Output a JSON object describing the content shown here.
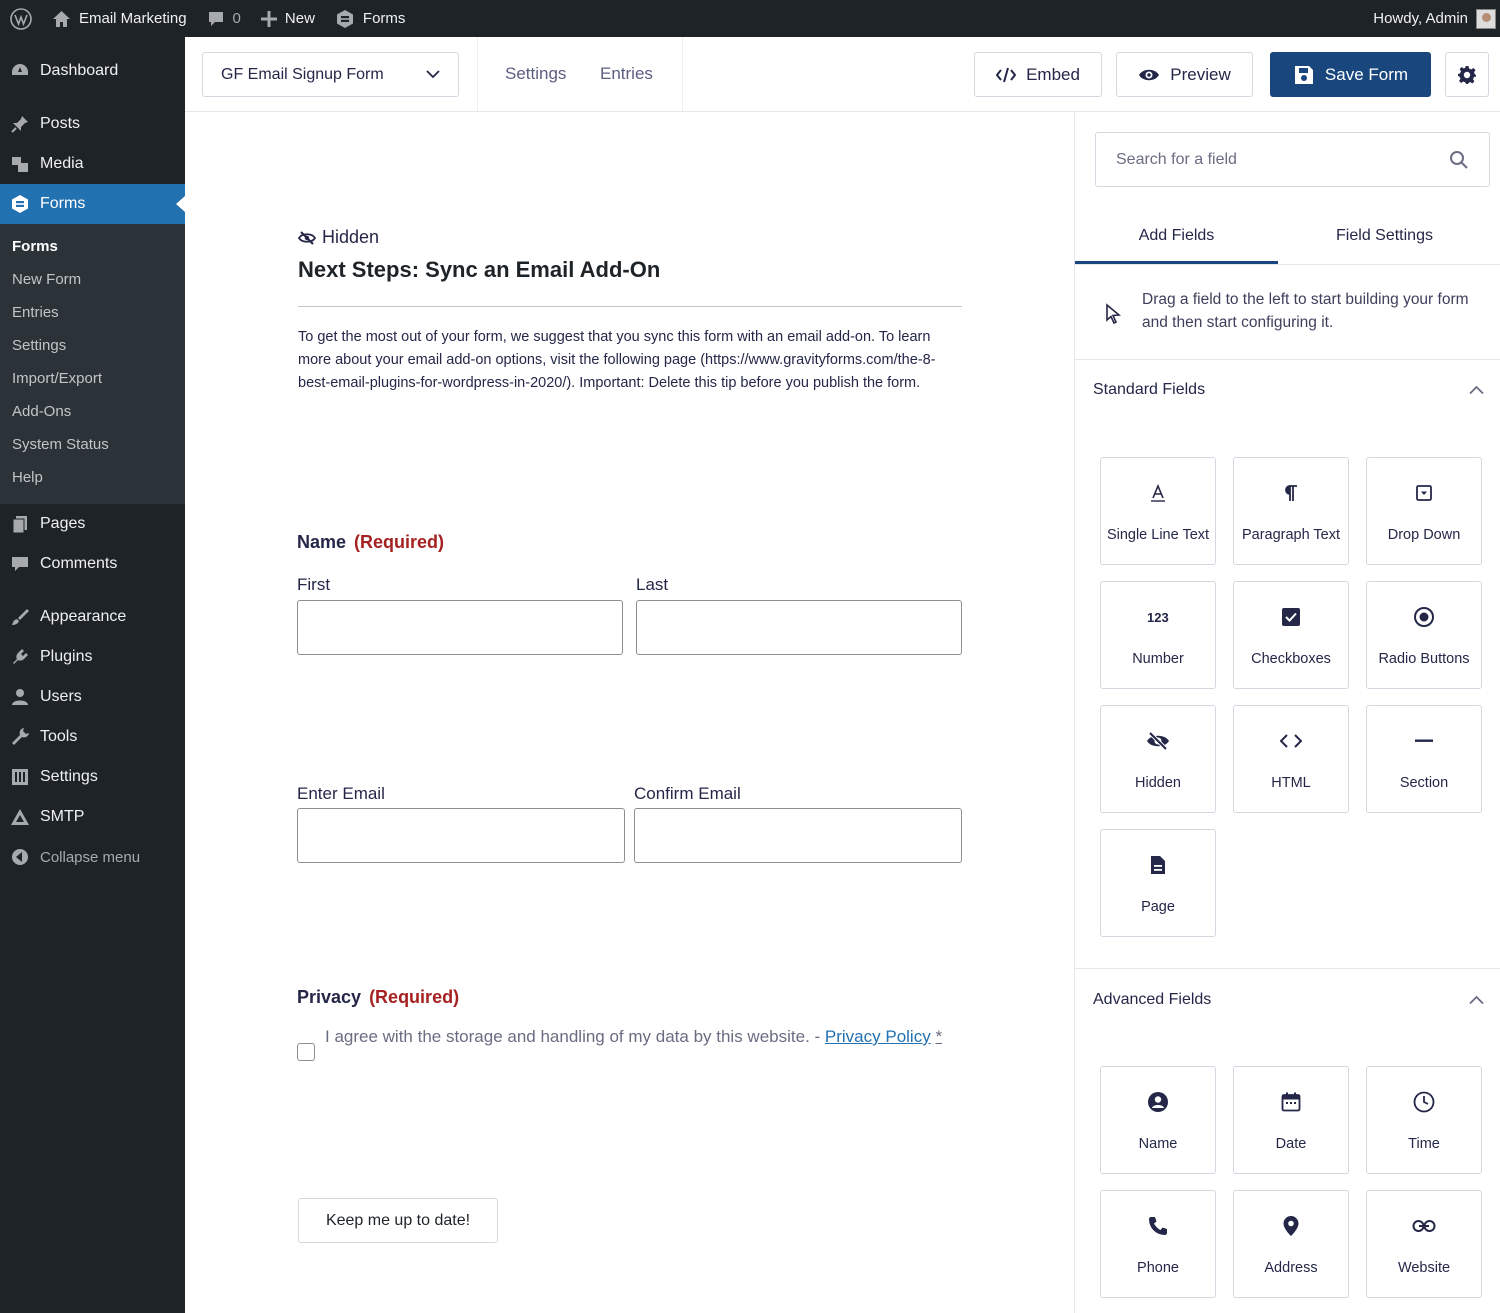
{
  "adminbar": {
    "site_name": "Email Marketing",
    "comments_count": "0",
    "new_label": "New",
    "forms_label": "Forms",
    "howdy": "Howdy, Admin"
  },
  "sidebar": {
    "dashboard": "Dashboard",
    "posts": "Posts",
    "media": "Media",
    "forms": "Forms",
    "submenu": [
      "Forms",
      "New Form",
      "Entries",
      "Settings",
      "Import/Export",
      "Add-Ons",
      "System Status",
      "Help"
    ],
    "pages": "Pages",
    "comments": "Comments",
    "appearance": "Appearance",
    "plugins": "Plugins",
    "users": "Users",
    "tools": "Tools",
    "settings": "Settings",
    "smtp": "SMTP",
    "collapse": "Collapse menu"
  },
  "toolbar": {
    "form_name": "GF Email Signup Form",
    "settings": "Settings",
    "entries": "Entries",
    "embed": "Embed",
    "preview": "Preview",
    "save": "Save Form"
  },
  "canvas": {
    "hidden_tag": "Hidden",
    "section_title": "Next Steps: Sync an Email Add-On",
    "section_desc": "To get the most out of your form, we suggest that you sync this form with an email add-on. To learn more about your email add-on options, visit the following page (https://www.gravityforms.com/the-8-best-email-plugins-for-wordpress-in-2020/). Important: Delete this tip before you publish the form.",
    "name_label": "Name",
    "required": "(Required)",
    "first": "First",
    "last": "Last",
    "enter_email": "Enter Email",
    "confirm_email": "Confirm Email",
    "privacy_label": "Privacy",
    "consent_text": "I agree with the storage and handling of my data by this website. - ",
    "privacy_link": "Privacy Policy",
    "asterisk": "*",
    "submit": "Keep me up to date!"
  },
  "panel": {
    "search_placeholder": "Search for a field",
    "tab_add": "Add Fields",
    "tab_settings": "Field Settings",
    "drag_tip": "Drag a field to the left to start building your form and then start configuring it.",
    "standard_title": "Standard Fields",
    "standard_fields": [
      "Single Line Text",
      "Paragraph Text",
      "Drop Down",
      "Number",
      "Checkboxes",
      "Radio Buttons",
      "Hidden",
      "HTML",
      "Section",
      "Page"
    ],
    "advanced_title": "Advanced Fields",
    "advanced_fields": [
      "Name",
      "Date",
      "Time",
      "Phone",
      "Address",
      "Website"
    ]
  },
  "colors": {
    "admin_dark": "#1d2327",
    "submenu_bg": "#2c3338",
    "wp_blue": "#2271b1",
    "primary_button": "#19477d",
    "required_red": "#a62121"
  }
}
